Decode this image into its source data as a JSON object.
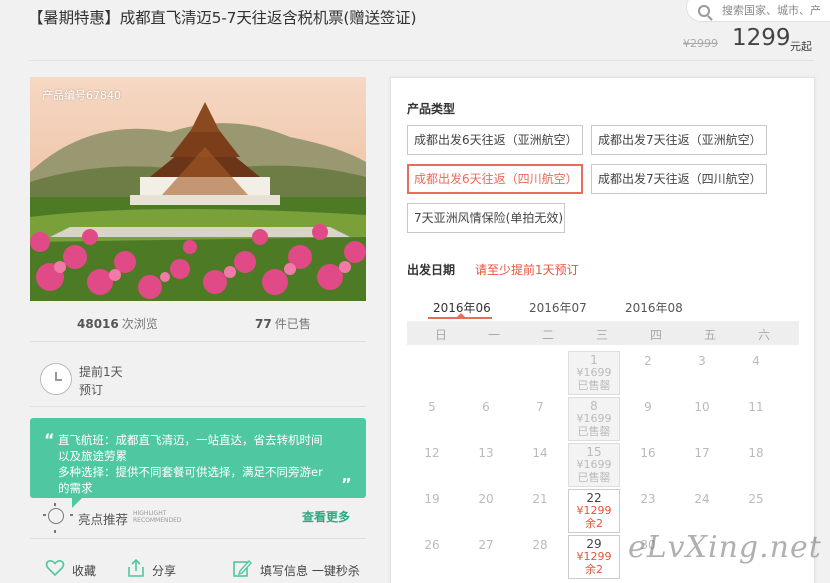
{
  "header": {
    "title": "【暑期特惠】成都直飞清迈5-7天往返含税机票(赠送签证)",
    "search_placeholder": "搜索国家、城市、产",
    "old_price": "¥2999",
    "price": "1299",
    "price_unit": "元起"
  },
  "product": {
    "code": "产品编号67840",
    "views_num": "48016",
    "views_label": "次浏览",
    "sold_num": "77",
    "sold_label": "件已售",
    "advance_line1": "提前1天",
    "advance_line2": "预订"
  },
  "highlights": {
    "quote_open": "“",
    "quote_close": "„",
    "lines": [
      "直飞航班：成都直飞清迈，一站直达，省去转机时间",
      "以及旅途劳累",
      "多种选择：提供不同套餐可供选择，满足不同旁游er",
      "的需求"
    ],
    "label": "亮点推荐",
    "label_en_1": "HIGHLIGHT",
    "label_en_2": "RECOMMENDED",
    "view_more": "查看更多"
  },
  "actions": {
    "favorite": "收藏",
    "share": "分享",
    "book": "填写信息 一键秒杀"
  },
  "booking": {
    "product_type_title": "产品类型",
    "options": [
      "成都出发6天往返（亚洲航空）",
      "成都出发7天往返（亚洲航空）",
      "成都出发6天往返（四川航空）",
      "成都出发7天往返（四川航空）",
      "7天亚洲风情保险(单拍无效)"
    ],
    "selected_option": 2,
    "date_title": "出发日期",
    "date_note": "请至少提前1天预订",
    "months": [
      "2016年06",
      "2016年07",
      "2016年08"
    ],
    "weekdays": [
      "日",
      "一",
      "二",
      "三",
      "四",
      "五",
      "六"
    ],
    "calendar": {
      "plain_rows": [
        [
          "",
          "",
          "",
          "",
          "2",
          "3",
          "4"
        ],
        [
          "5",
          "6",
          "7",
          "",
          "9",
          "10",
          "11"
        ],
        [
          "12",
          "13",
          "14",
          "",
          "16",
          "17",
          "18"
        ],
        [
          "19",
          "20",
          "21",
          "",
          "23",
          "24",
          "25"
        ],
        [
          "26",
          "27",
          "28",
          "",
          "30",
          "",
          ""
        ]
      ],
      "wednesday_cells": [
        {
          "day": "1",
          "price": "¥1699",
          "status": "已售罄",
          "state": "sold"
        },
        {
          "day": "8",
          "price": "¥1699",
          "status": "已售罄",
          "state": "sold"
        },
        {
          "day": "15",
          "price": "¥1699",
          "status": "已售罄",
          "state": "sold"
        },
        {
          "day": "22",
          "price": "¥1299",
          "status": "余2",
          "state": "avail"
        },
        {
          "day": "29",
          "price": "¥1299",
          "status": "余2",
          "state": "avail"
        }
      ]
    }
  },
  "watermark": "eLvXing.net",
  "colors": {
    "accent_red": "#e8543c",
    "highlight_green": "#4fc8a1",
    "link_green": "#2fa882"
  }
}
